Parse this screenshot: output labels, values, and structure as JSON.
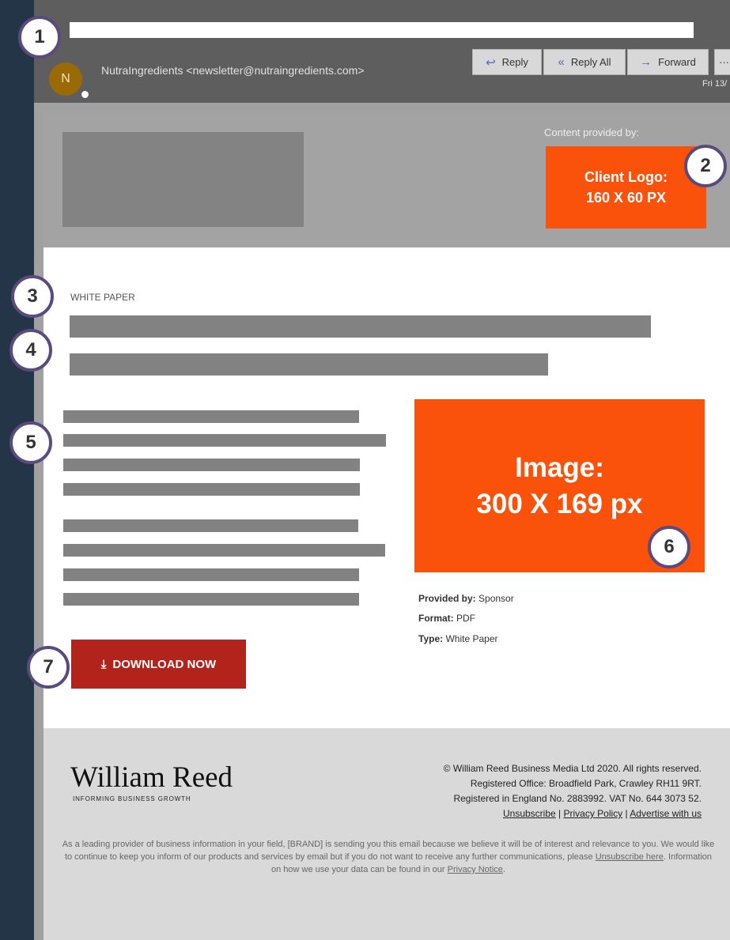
{
  "header": {
    "sender": "NutraIngredients <newsletter@nutraingredients.com>",
    "avatar_initial": "N",
    "actions": {
      "reply": "Reply",
      "reply_all": "Reply All",
      "forward": "Forward",
      "more": "···"
    },
    "date": "Fri 13/"
  },
  "banner": {
    "content_provided_by": "Content provided by:",
    "client_logo_line1": "Client Logo:",
    "client_logo_line2": "160 X 60 PX"
  },
  "article": {
    "category": "WHITE PAPER",
    "image_line1": "Image:",
    "image_line2": "300 X 169 px",
    "meta": [
      {
        "label": "Provided by:",
        "value": "Sponsor"
      },
      {
        "label": "Format:",
        "value": "PDF"
      },
      {
        "label": "Type:",
        "value": "White Paper"
      }
    ],
    "download_label": "DOWNLOAD NOW"
  },
  "footer": {
    "brand_name": "William Reed",
    "brand_tagline": "INFORMING BUSINESS GROWTH",
    "legal": [
      "© William Reed Business Media Ltd 2020. All rights reserved.",
      "Registered Office: Broadfield Park, Crawley RH11 9RT.",
      "Registered in England No. 2883992. VAT No. 644 3073 52."
    ],
    "links": {
      "unsubscribe": "Unsubscribe",
      "privacy_policy": "Privacy Policy",
      "advertise": "Advertise with us",
      "separator": " | "
    },
    "disclaimer_1": "As a leading provider of business information in your field, [BRAND] is sending you this email because we believe it will be of interest and relevance to you. We would like to continue to keep you inform of our products and services by email but if you do not want to receive any further communications, please ",
    "disclaimer_link_1": "Unsubscribe here",
    "disclaimer_2": ". Information on how we use your data can be found in our ",
    "disclaimer_link_2": "Privacy Notice",
    "disclaimer_3": "."
  },
  "markers": [
    "1",
    "2",
    "3",
    "4",
    "5",
    "6",
    "7"
  ],
  "colors": {
    "accent_orange": "#fb520b",
    "download_red": "#b2231c",
    "marker_border": "#5a4a7e",
    "sidebar": "#233546"
  }
}
